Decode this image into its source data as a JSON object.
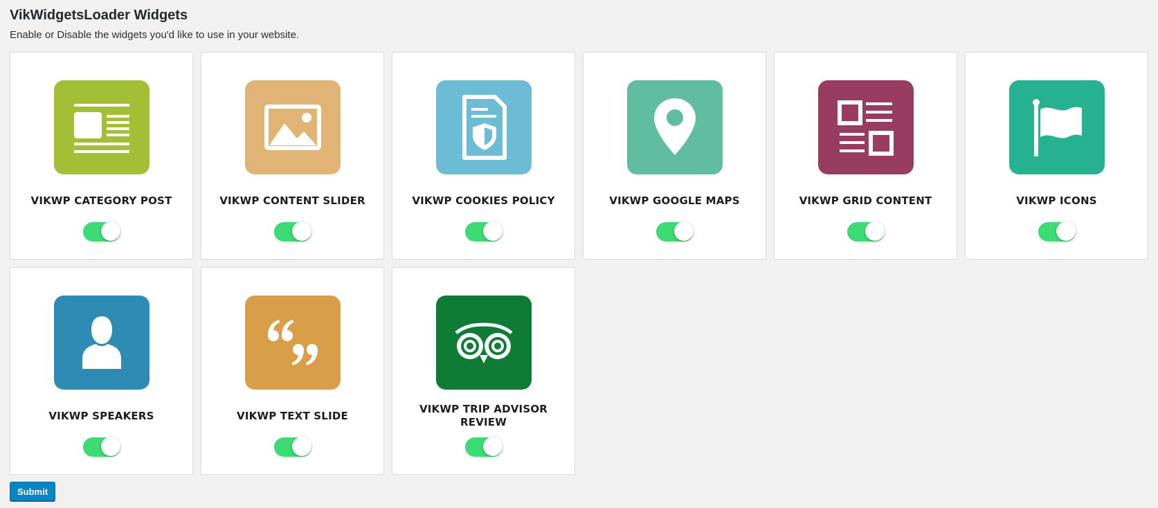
{
  "header": {
    "title": "VikWidgetsLoader Widgets",
    "description": "Enable or Disable the widgets you'd like to use in your website."
  },
  "widgets": [
    {
      "title": "VIKWP CATEGORY POST",
      "icon": "category-post-icon",
      "color": "#a3bf35",
      "enabled": true
    },
    {
      "title": "VIKWP CONTENT SLIDER",
      "icon": "image-icon",
      "color": "#e1b476",
      "enabled": true
    },
    {
      "title": "VIKWP COOKIES POLICY",
      "icon": "shield-document-icon",
      "color": "#6bbcd4",
      "enabled": true
    },
    {
      "title": "VIKWP GOOGLE MAPS",
      "icon": "map-pin-icon",
      "color": "#60bd9f",
      "enabled": true
    },
    {
      "title": "VIKWP GRID CONTENT",
      "icon": "grid-content-icon",
      "color": "#983c62",
      "enabled": true
    },
    {
      "title": "VIKWP ICONS",
      "icon": "flag-icon",
      "color": "#26b191",
      "enabled": true
    },
    {
      "title": "VIKWP SPEAKERS",
      "icon": "person-icon",
      "color": "#2e8bb4",
      "enabled": true
    },
    {
      "title": "VIKWP TEXT SLIDE",
      "icon": "quote-icon",
      "color": "#d89e48",
      "enabled": true
    },
    {
      "title": "VIKWP TRIP ADVISOR REVIEW",
      "icon": "owl-icon",
      "color": "#0e7c35",
      "enabled": true
    }
  ],
  "toggle_color": "#3ddb73",
  "submit_label": "Submit"
}
